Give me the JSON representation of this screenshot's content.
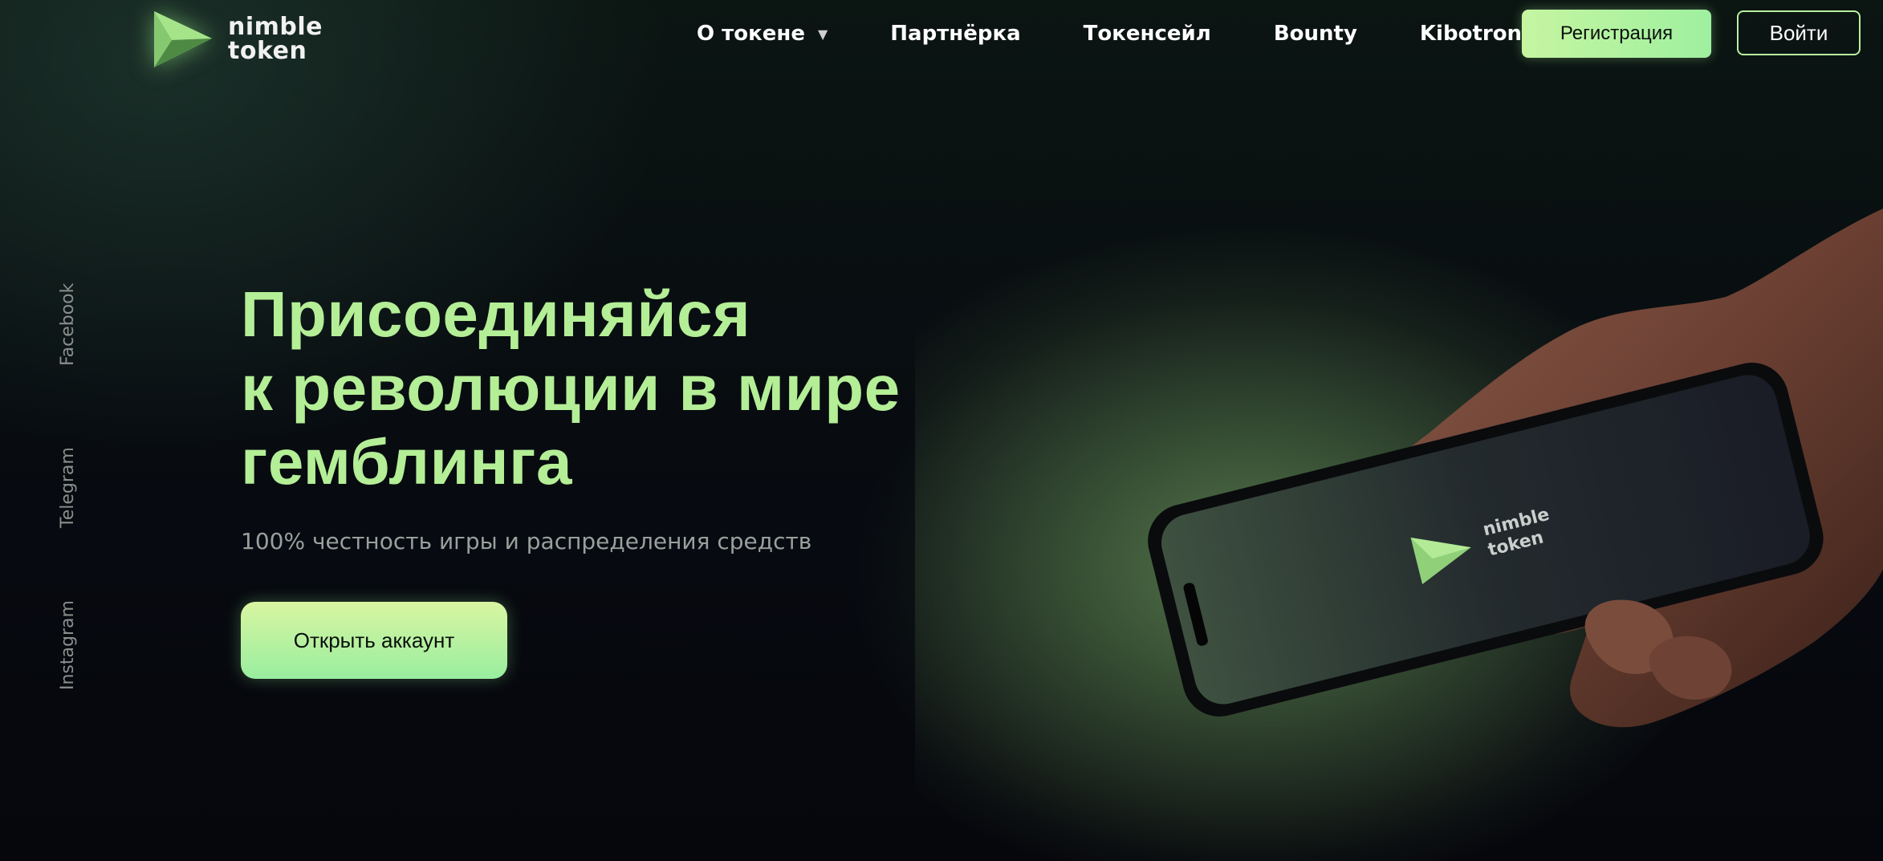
{
  "brand": {
    "name_line1": "nimble",
    "name_line2": "token",
    "accent_color": "#b4ee96"
  },
  "nav": {
    "items": [
      {
        "label": "О токене",
        "has_dropdown": true
      },
      {
        "label": "Партнёрка"
      },
      {
        "label": "Токенсейл"
      },
      {
        "label": "Bounty"
      },
      {
        "label": "Kibotrons"
      }
    ],
    "register_label": "Регистрация",
    "login_label": "Войти"
  },
  "social": {
    "links": [
      "Facebook",
      "Telegram",
      "Instagram"
    ]
  },
  "hero": {
    "title_line1": "Присоединяйся",
    "title_line2": "к революции в мире",
    "title_line3": "гемблинга",
    "subtitle": "100% честность игры и распределения средств",
    "cta_label": "Открыть аккаунт"
  },
  "phone": {
    "screen_brand_line1": "nimble",
    "screen_brand_line2": "token"
  },
  "icons": {
    "logo": "triangle-logo-icon",
    "dropdown": "caret-down-icon"
  }
}
